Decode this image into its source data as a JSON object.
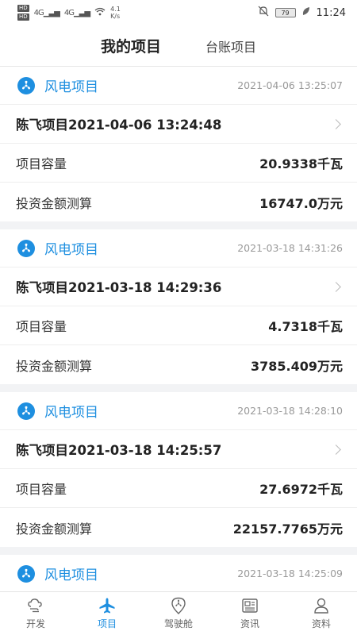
{
  "status_bar": {
    "hd1": "HD",
    "hd2": "HD",
    "net1": "4G",
    "net2": "4G",
    "speed_value": "4.1",
    "speed_unit": "K/s",
    "battery": "79",
    "time": "11:24"
  },
  "tabs": [
    {
      "label": "我的项目",
      "active": true
    },
    {
      "label": "台账项目",
      "active": false
    }
  ],
  "projects": [
    {
      "type": "风电项目",
      "time": "2021-04-06 13:25:07",
      "name": "陈飞项目2021-04-06 13:24:48",
      "capacity_label": "项目容量",
      "capacity": "20.9338千瓦",
      "investment_label": "投资金额测算",
      "investment": "16747.0万元"
    },
    {
      "type": "风电项目",
      "time": "2021-03-18 14:31:26",
      "name": "陈飞项目2021-03-18 14:29:36",
      "capacity_label": "项目容量",
      "capacity": "4.7318千瓦",
      "investment_label": "投资金额测算",
      "investment": "3785.409万元"
    },
    {
      "type": "风电项目",
      "time": "2021-03-18 14:28:10",
      "name": "陈飞项目2021-03-18 14:25:57",
      "capacity_label": "项目容量",
      "capacity": "27.6972千瓦",
      "investment_label": "投资金额测算",
      "investment": "22157.7765万元"
    },
    {
      "type": "风电项目",
      "time": "2021-03-18 14:25:09"
    }
  ],
  "nav": [
    {
      "label": "开发",
      "icon": "cloud-wind-icon",
      "active": false
    },
    {
      "label": "项目",
      "icon": "airplane-icon",
      "active": true
    },
    {
      "label": "驾驶舱",
      "icon": "map-pin-fan-icon",
      "active": false
    },
    {
      "label": "资讯",
      "icon": "news-icon",
      "active": false
    },
    {
      "label": "资料",
      "icon": "person-icon",
      "active": false
    }
  ],
  "colors": {
    "accent": "#1e8fe0",
    "background": "#f2f3f5"
  }
}
